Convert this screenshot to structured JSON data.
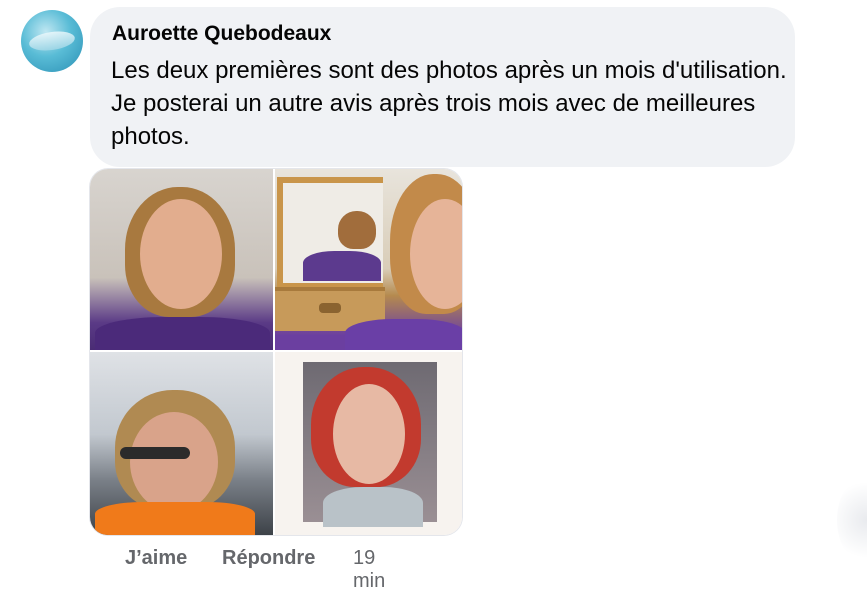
{
  "comment": {
    "author": "Auroette Quebodeaux",
    "text": "Les deux premières sont des photos après un mois d'utilisation. Je posterai un autre avis après trois mois avec de meilleures photos."
  },
  "actions": {
    "like_label": "J’aime",
    "reply_label": "Répondre",
    "timestamp": "19 min"
  },
  "colors": {
    "bubble_bg": "#f0f2f5",
    "text": "#050505",
    "secondary_text": "#65676b"
  },
  "icons": {
    "avatar": "profile-avatar-fish"
  }
}
